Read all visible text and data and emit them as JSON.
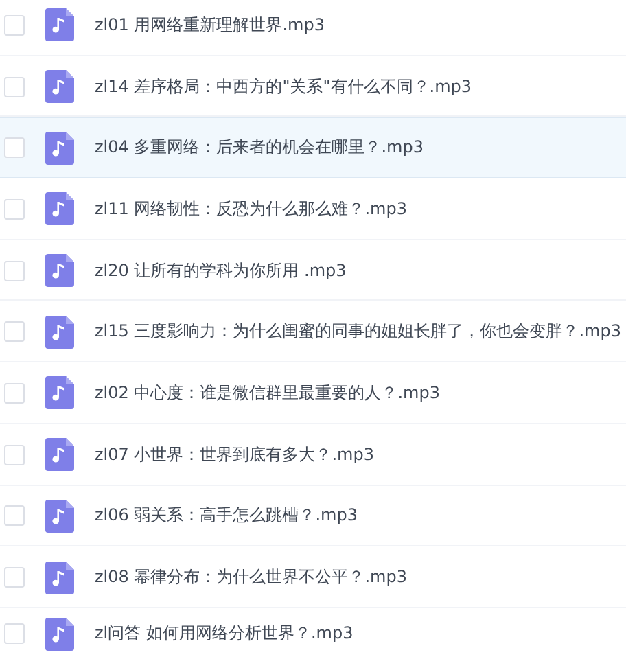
{
  "files": [
    {
      "name": "zl01 用网络重新理解世界.mp3",
      "checked": false,
      "selected": false
    },
    {
      "name": "zl14 差序格局：中西方的\"关系\"有什么不同？.mp3",
      "checked": false,
      "selected": false
    },
    {
      "name": "zl04 多重网络：后来者的机会在哪里？.mp3",
      "checked": false,
      "selected": true
    },
    {
      "name": "zl11 网络韧性：反恐为什么那么难？.mp3",
      "checked": false,
      "selected": false
    },
    {
      "name": "zl20 让所有的学科为你所用 .mp3",
      "checked": false,
      "selected": false
    },
    {
      "name": "zl15 三度影响力：为什么闺蜜的同事的姐姐长胖了，你也会变胖？.mp3",
      "checked": false,
      "selected": false
    },
    {
      "name": "zl02 中心度：谁是微信群里最重要的人？.mp3",
      "checked": false,
      "selected": false
    },
    {
      "name": "zl07 小世界：世界到底有多大？.mp3",
      "checked": false,
      "selected": false
    },
    {
      "name": "zl06 弱关系：高手怎么跳槽？.mp3",
      "checked": false,
      "selected": false
    },
    {
      "name": "zl08 幂律分布：为什么世界不公平？.mp3",
      "checked": false,
      "selected": false
    },
    {
      "name": "zl问答 如何用网络分析世界？.mp3",
      "checked": false,
      "selected": false
    }
  ]
}
